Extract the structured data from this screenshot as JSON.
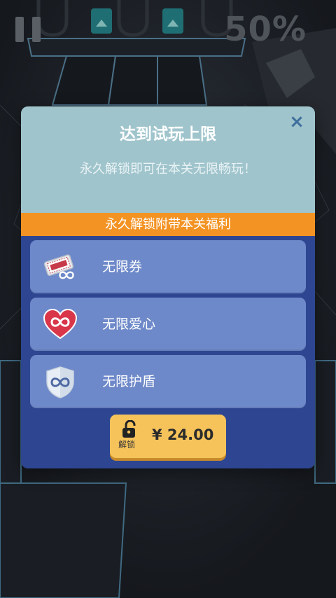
{
  "hud": {
    "progress_text": "50%"
  },
  "modal": {
    "title": "达到试玩上限",
    "subtitle": "永久解锁即可在本关无限畅玩！",
    "close_symbol": "×",
    "benefits_banner": "永久解锁附带本关福利",
    "benefits": [
      {
        "label": "无限券",
        "icon": "infinite-ticket-icon"
      },
      {
        "label": "无限爱心",
        "icon": "infinite-heart-icon"
      },
      {
        "label": "无限护盾",
        "icon": "infinite-shield-icon"
      }
    ],
    "unlock_button": {
      "caption": "解锁",
      "price": "¥ 24.00"
    }
  },
  "colors": {
    "modal_header": "#9fc4cc",
    "modal_body": "#2e4691",
    "banner": "#f39323",
    "benefit_item": "#6e89c9",
    "unlock_button": "#f6c35b"
  }
}
